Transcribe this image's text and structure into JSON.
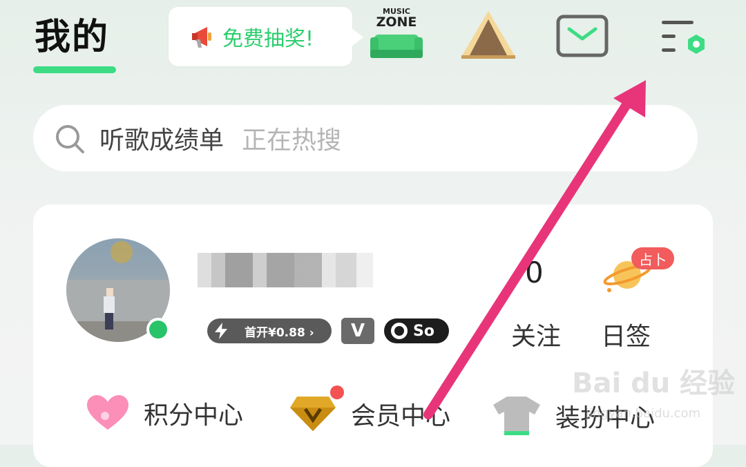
{
  "header": {
    "title": "我的",
    "promo_bubble": "免费抽奖!",
    "music_zone_lines": [
      "MUSIC",
      "ZONE"
    ]
  },
  "search": {
    "query": "听歌成绩单",
    "hot_hint": "正在热搜"
  },
  "profile": {
    "vip_pill_label": "首开¥0.88 ›",
    "v_badge": "V",
    "svip_label": "So",
    "follow_count": "0",
    "follow_label": "关注",
    "checkin_label": "日签",
    "divination_tag": "占卜"
  },
  "menu": {
    "points_center": "积分中心",
    "vip_center": "会员中心",
    "dress_center": "装扮中心"
  },
  "watermark": {
    "text": "Bai du 经验",
    "sub": "jingyan.baidu.com"
  },
  "colors": {
    "accent_green": "#3ddc84",
    "arrow_pink": "#e8357a",
    "red_dot": "#f25252"
  }
}
